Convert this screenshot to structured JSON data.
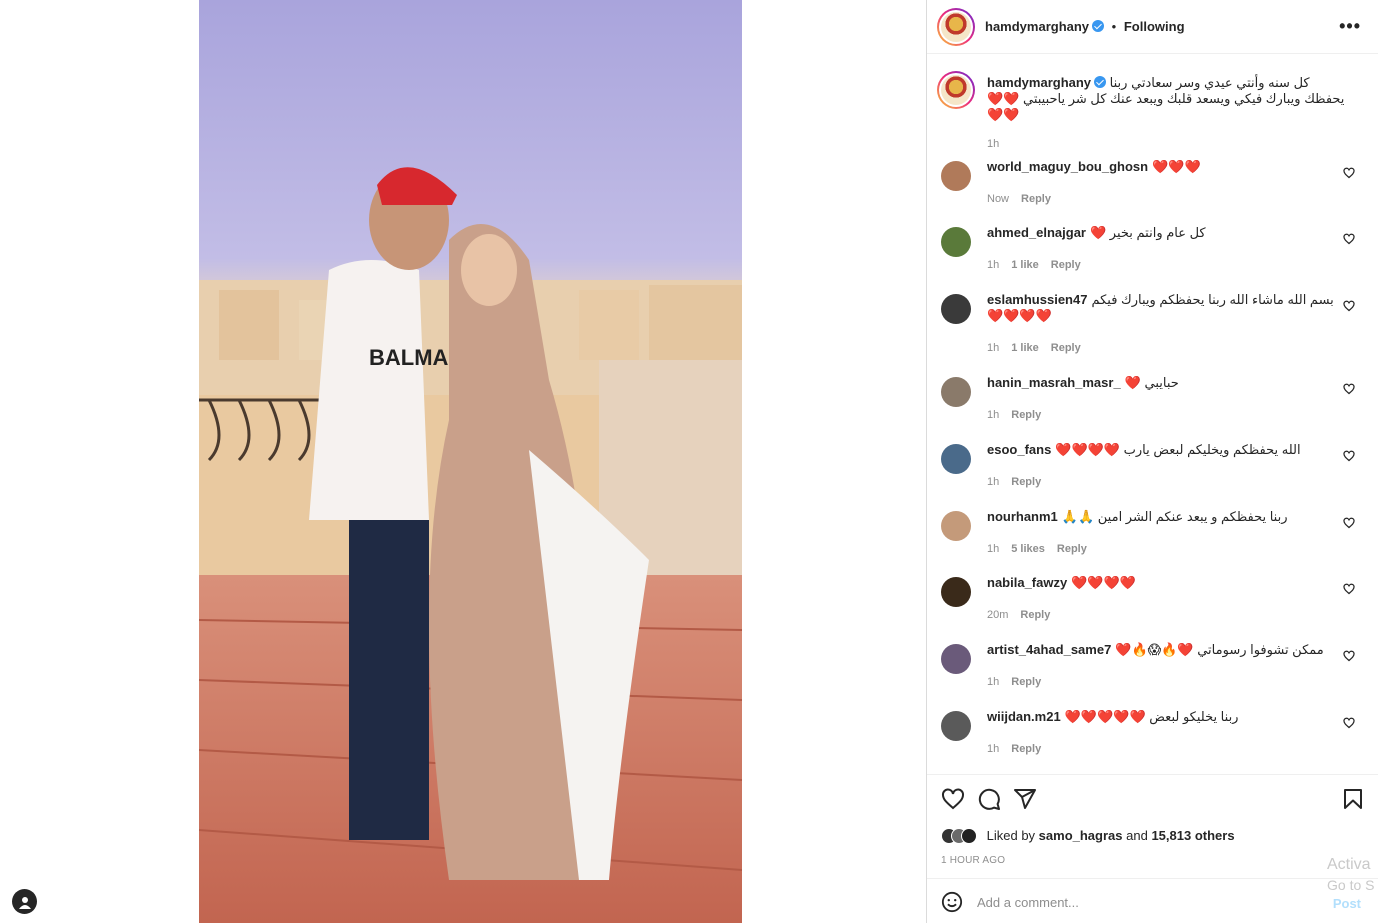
{
  "post": {
    "author": "hamdymarghany",
    "follow_status": "Following",
    "more_label": "•••",
    "caption": "كل سنه وأنتي عيدي وسر سعادتي ربنا يحفظك ويبارك فيكي ويسعد قلبك ويبعد عنك كل شر ياحبيبتي ❤️❤️❤️❤️",
    "caption_time": "1h",
    "liked_by_prefix": "Liked by",
    "liked_by_user": "samo_hagras",
    "liked_by_and": "and",
    "liked_by_others": "15,813 others",
    "post_time": "1 HOUR AGO"
  },
  "comments": [
    {
      "user": "world_maguy_bou_ghosn",
      "text": "❤️❤️❤️",
      "time": "Now",
      "likes": "",
      "reply": "Reply",
      "avatar": "#b07a5a"
    },
    {
      "user": "ahmed_elnajgar",
      "text": "كل عام وانتم بخير ❤️",
      "time": "1h",
      "likes": "1 like",
      "reply": "Reply",
      "avatar": "#5a7a3a"
    },
    {
      "user": "eslamhussien47",
      "text": "بسم الله ماشاء الله ربنا يحفظكم ويبارك فيكم ❤️❤️❤️❤️",
      "time": "1h",
      "likes": "1 like",
      "reply": "Reply",
      "avatar": "#3a3a3a"
    },
    {
      "user": "hanin_masrah_masr_",
      "text": "حبايبي ❤️",
      "time": "1h",
      "likes": "",
      "reply": "Reply",
      "avatar": "#8a7a6a"
    },
    {
      "user": "esoo_fans",
      "text": "الله يحفظكم ويخليكم لبعض يارب ❤️❤️❤️❤️",
      "time": "1h",
      "likes": "",
      "reply": "Reply",
      "avatar": "#4a6a8a"
    },
    {
      "user": "nourhanm1",
      "text": "ربنا يحفظكم و يبعد عنكم الشر امين 🙏🙏",
      "time": "1h",
      "likes": "5 likes",
      "reply": "Reply",
      "avatar": "#c49a7a"
    },
    {
      "user": "nabila_fawzy",
      "text": "❤️❤️❤️❤️",
      "time": "20m",
      "likes": "",
      "reply": "Reply",
      "avatar": "#3a2a1a"
    },
    {
      "user": "artist_4ahad_same7",
      "text": "ممكن تشوفوا رسوماتي ❤️🔥😱🔥❤️",
      "time": "1h",
      "likes": "",
      "reply": "Reply",
      "avatar": "#6a5a7a"
    },
    {
      "user": "wiijdan.m21",
      "text": "ربنا يخليكو لبعض ❤️❤️❤️❤️❤️",
      "time": "1h",
      "likes": "",
      "reply": "Reply",
      "avatar": "#5a5a5a"
    }
  ],
  "composer": {
    "placeholder": "Add a comment...",
    "post_label": "Post"
  },
  "watermark": {
    "line1": "Activa",
    "line2": "Go to S"
  },
  "icons": {
    "like": "heart-icon",
    "comment": "comment-icon",
    "share": "send-icon",
    "save": "bookmark-icon",
    "emoji": "emoji-icon",
    "tag": "user-tag-icon"
  },
  "colors": {
    "verified": "#3897f0",
    "heart": "#ed4956",
    "muted": "#8e8e8e",
    "post_button": "#b2dffc"
  }
}
